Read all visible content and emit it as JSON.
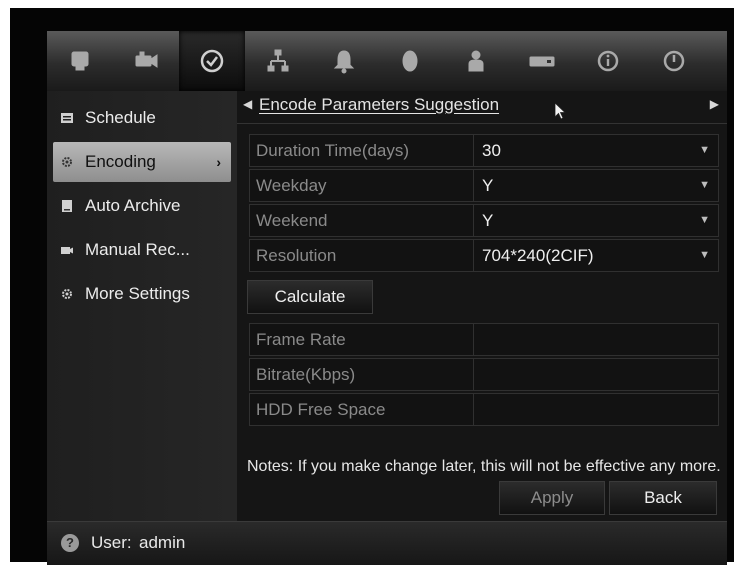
{
  "topbar": {
    "tabs": [
      {
        "icon": "monitor-icon"
      },
      {
        "icon": "camera-icon"
      },
      {
        "icon": "recording-clock-icon",
        "active": true
      },
      {
        "icon": "network-icon"
      },
      {
        "icon": "alarm-bell-icon"
      },
      {
        "icon": "device-icon"
      },
      {
        "icon": "user-icon"
      },
      {
        "icon": "hdd-icon"
      },
      {
        "icon": "info-icon"
      },
      {
        "icon": "power-icon"
      }
    ]
  },
  "sidebar": {
    "items": [
      {
        "label": "Schedule",
        "icon": "schedule-icon"
      },
      {
        "label": "Encoding",
        "icon": "encoding-gear-icon",
        "active": true
      },
      {
        "label": "Auto Archive",
        "icon": "archive-icon"
      },
      {
        "label": "Manual Rec...",
        "icon": "manual-rec-icon"
      },
      {
        "label": "More Settings",
        "icon": "settings-icon"
      }
    ]
  },
  "content": {
    "breadcrumb_title": "Encode Parameters Suggestion",
    "fields": [
      {
        "label": "Duration Time(days)",
        "value": "30"
      },
      {
        "label": "Weekday",
        "value": "Y"
      },
      {
        "label": "Weekend",
        "value": "Y"
      },
      {
        "label": "Resolution",
        "value": "704*240(2CIF)"
      }
    ],
    "calculate_label": "Calculate",
    "results": [
      {
        "label": "Frame Rate",
        "value": ""
      },
      {
        "label": "Bitrate(Kbps)",
        "value": ""
      },
      {
        "label": "HDD Free Space",
        "value": ""
      }
    ],
    "notes": "Notes: If you make change later, this will not be effective any more.",
    "apply_label": "Apply",
    "back_label": "Back"
  },
  "status": {
    "user_prefix": "User:",
    "user_name": "admin"
  }
}
